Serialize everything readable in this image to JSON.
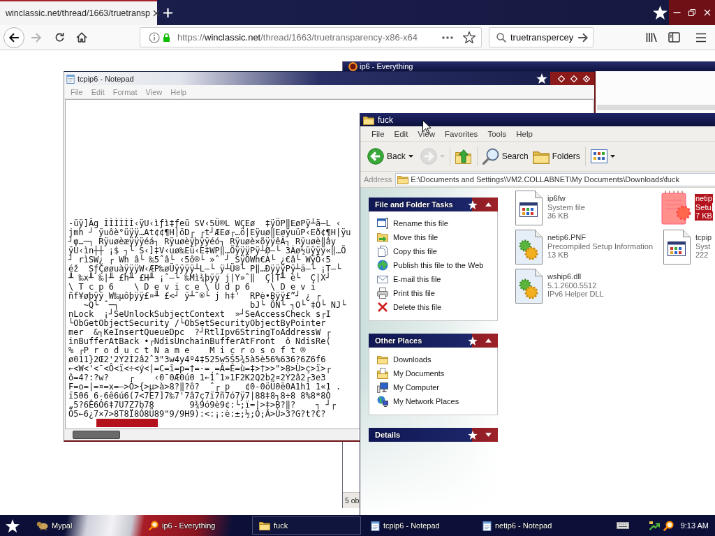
{
  "browser": {
    "tabs": [
      {
        "title": "winclassic.net/thread/1663/truetransp",
        "selected": true
      }
    ],
    "url": {
      "scheme": "https://",
      "host": "winclassic.net",
      "path": "/thread/1663/truetransparency-x86-x64"
    },
    "search": {
      "value": "truetranspercey"
    }
  },
  "everything": {
    "title": "ip6 - Everything",
    "status": "5 ob"
  },
  "notepad": {
    "title": "tcpip6 - Notepad",
    "menu": [
      {
        "label": "File",
        "disabled": true
      },
      {
        "label": "Edit",
        "disabled": true
      },
      {
        "label": "Format",
        "disabled": true
      },
      {
        "label": "View",
        "disabled": true
      },
      {
        "label": "Help",
        "disabled": true
      }
    ],
    "lines": [
      "-üÿ]Âg ÌÌÌÌÌÌ‹ÿU‹ìƒì‡ƒeü SV‹5Ü®L WÇEø  ‡ÿÖP‖EøPÿ┴ä–L ‹",
      "jmh ┘ ÿuôè°üÿÿ…At¢¢¶H|öD┌ ┌t┘ÆEø┌…ö|Eÿuø‖EøÿuüP‹Eð¢¶H|ÿu",
      "┘φ…─┐ Rÿuøèæÿÿÿéá┐ Rÿuøèÿþÿÿéó┐ Rÿuøè×õÿÿêÂ┐ Rÿuøè‖ây",
      "ÿU‹ìn┼┼ ¡$ ┐└ S‹]‡V‹uø‰Eü‹E‡WP‖…ÕÿÿÿPÿ┴Ø–└ 3Àø½üÿÿÿ«‖…Õ",
      "┘ rìSW¿ ┌ Wh â└ ‰5ˆâ└ ‹5ô®└ »ˆ ┘ SÿÖWh€À└ ¿€â└ WÿÖ‹5",
      "éž  SƒÇøøuàÿÿÿW‹ÆP‰øÜÿÿÿÿ┴L–└ ÿ┴Ü®└ P‖…ÐÿÿÿPÿ┴ä–└ ¡T–└",
      "╨ ‰x╨ ‰|╨ £h╨ £H╨ ¡ˆ–└ ‰Mì¾þÿÿ j|Y»ˆ‖  Ç|T╨ è└  Ç|X┘",
      "\\ T c p 6    \\ D e v i c e \\ U d p 6    \\ D e v i",
      "ñf¥øþÿÿ W‰µôþÿÿ£¤╨ £<┘ ÿ┴˜®└ j h‡'  RPè•Bÿÿ£”┘ ¿ ┌",
      "   ~Q└ ˆ─┐                          bJ└ ÔN└ ┐O└ ‡O└ NJ└",
      "nLock  ¡┘SeUnlockSubjectContext  »┘SeAccessCheck s┌I",
      "└ObGetObjectSecurity /└ObSetSecurityObjectByPointer",
      "mer  &┐KeInsertQueueDpc  ?┘RtlIpv6StringToAddressW ┌",
      "inBufferAtBack •┌NdisUnchainBufferAtFront  ô NdisRe(",
      "% ┌P r o d u c t N a m e    M i c r o s o f t ®",
      "ø011}2Œ2'2Ý2Ì2â2ˆ3\"3w4y4º4‡525w5Š5¾5à5è56%636?6Z6f6",
      "←<W<'<¯<Ô<ï<÷<ý<|=C=ï=p=†=-=¸=Â=Ê=ù=‡>†>>\">8>Ù>ç>ï>┌",
      "ô=4?:?w?    ┌    ‹0¯0Æ0ú0 1←1ˆ1»1F2K2Q2b2¤2Ý2â2┌3e3",
      "F=o=|=¤=x=–>Ò>{>µ>à>8?‖?ô?  ˆ┌ p   ¢0-0öÜ0ë0A1h1 1«1 .",
      "ï506 6-6ê6ú6(7<7E7]7‰7'7â7ç7ï7ñ7ó7ÿ7|88‡8┐8÷8 8%8*8Ò",
      "„5?6Ê6Ó6‡7U7Z7b78       9¾9ó9è9¢:└;ï=|>‡>B?‖?    ┐ ┘┌",
      "Ò5←6¿7×7>8T8Ï8Ó8Ü89\"9/9H9):<:¡:è:±;½;Ó;Â>Ù>3?G?t?€?"
    ],
    "highlight": true
  },
  "explorer": {
    "title": "fuck",
    "menu": [
      {
        "label": "File",
        "disabled": false
      },
      {
        "label": "Edit",
        "disabled": false
      },
      {
        "label": "View",
        "disabled": false
      },
      {
        "label": "Favorites",
        "disabled": false
      },
      {
        "label": "Tools",
        "disabled": false
      },
      {
        "label": "Help",
        "disabled": false
      }
    ],
    "toolbar": [
      {
        "kind": "back",
        "label": "Back",
        "disabled": false
      },
      {
        "kind": "forward",
        "disabled": true
      },
      {
        "kind": "up",
        "disabled": false
      },
      {
        "kind": "search",
        "label": "Search",
        "disabled": false
      },
      {
        "kind": "folders",
        "label": "Folders",
        "disabled": false
      },
      {
        "kind": "views",
        "disabled": false
      }
    ],
    "address": {
      "label": "Address",
      "value": "E:\\Documents and Settings\\VM2.COLLABNET\\My Documents\\Downloads\\fuck"
    },
    "panels": [
      {
        "title": "File and Folder Tasks",
        "expanded": true,
        "items": [
          "Rename this file",
          "Move this file",
          "Copy this file",
          "Publish this file to the Web",
          "E-mail this file",
          "Print this file",
          "Delete this file"
        ]
      },
      {
        "title": "Other Places",
        "expanded": true,
        "items": [
          "Downloads",
          "My Documents",
          "My Computer",
          "My Network Places"
        ]
      },
      {
        "title": "Details",
        "expanded": false
      }
    ],
    "files": [
      {
        "kind": "system",
        "lines": [
          "ip6fw",
          "System file",
          "36 KB"
        ],
        "selected": false
      },
      {
        "kind": "inf",
        "lines": [
          "netip",
          "Setu",
          "7 KB"
        ],
        "selected": true
      },
      {
        "kind": "binary",
        "lines": [
          "netip6.PNF",
          "Precompiled Setup Information",
          "13 KB"
        ],
        "selected": false
      },
      {
        "kind": "system",
        "lines": [
          "tcpip",
          "Syst",
          "222"
        ],
        "selected": false
      },
      {
        "kind": "binary",
        "lines": [
          "wship6.dll",
          "5.1.2600.5512",
          "IPv6 Helper DLL"
        ],
        "selected": false
      }
    ]
  },
  "taskbar": {
    "buttons": [
      {
        "kind": "browser",
        "label": "Mypal",
        "selected": false
      },
      {
        "kind": "search",
        "label": "ip6 - Everything",
        "selected": false
      },
      {
        "kind": "folder",
        "label": "fuck",
        "selected": true
      },
      {
        "kind": "notepad",
        "label": "tcpip6 - Notepad",
        "selected": false
      },
      {
        "kind": "notepad",
        "label": "netip6 - Notepad",
        "selected": false
      }
    ],
    "clock": "9:13 AM"
  }
}
